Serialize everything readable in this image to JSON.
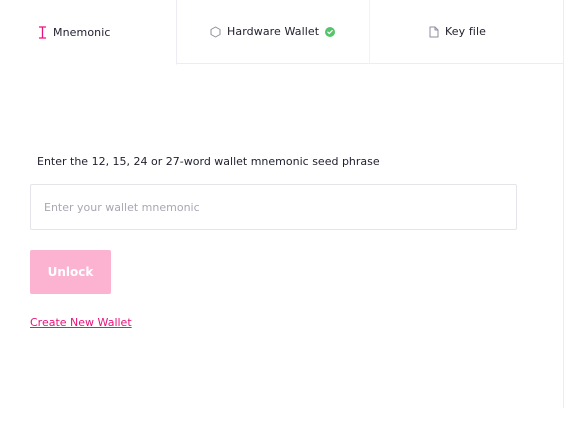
{
  "tabs": [
    {
      "label": "Mnemonic",
      "icon": "text-cursor-icon",
      "active": true
    },
    {
      "label": "Hardware Wallet",
      "icon": "hexagon-icon",
      "status_icon": "check-circle-icon",
      "active": false
    },
    {
      "label": "Key file",
      "icon": "file-icon",
      "active": false
    }
  ],
  "form": {
    "instruction": "Enter the 12, 15, 24 or 27-word wallet mnemonic seed phrase",
    "input_value": "",
    "input_placeholder": "Enter your wallet mnemonic",
    "unlock_label": "Unlock"
  },
  "links": {
    "create_wallet": "Create New Wallet"
  },
  "colors": {
    "accent": "#e5137a",
    "button_disabled": "#fbb3d1",
    "success": "#55c46b",
    "border": "#ececf2"
  }
}
